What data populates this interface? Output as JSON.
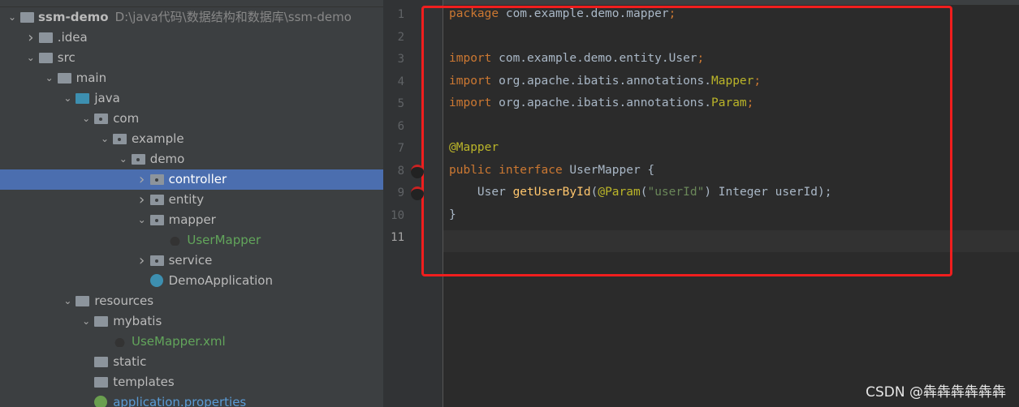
{
  "project": {
    "root": {
      "name": "ssm-demo",
      "path": "D:\\java代码\\数据结构和数据库\\ssm-demo"
    },
    "items": [
      {
        "label": ".idea",
        "level": 1,
        "chevron": "right",
        "icon": "folder"
      },
      {
        "label": "src",
        "level": 1,
        "chevron": "down",
        "icon": "folder"
      },
      {
        "label": "main",
        "level": 2,
        "chevron": "down",
        "icon": "folder"
      },
      {
        "label": "java",
        "level": 3,
        "chevron": "down",
        "icon": "source-folder"
      },
      {
        "label": "com",
        "level": 4,
        "chevron": "down",
        "icon": "package"
      },
      {
        "label": "example",
        "level": 5,
        "chevron": "down",
        "icon": "package"
      },
      {
        "label": "demo",
        "level": 6,
        "chevron": "down",
        "icon": "package"
      },
      {
        "label": "controller",
        "level": 7,
        "chevron": "right",
        "icon": "package",
        "selected": true
      },
      {
        "label": "entity",
        "level": 7,
        "chevron": "right",
        "icon": "package"
      },
      {
        "label": "mapper",
        "level": 7,
        "chevron": "down",
        "icon": "package"
      },
      {
        "label": "UserMapper",
        "level": 8,
        "chevron": "",
        "icon": "mybatis-mapper",
        "color": "green"
      },
      {
        "label": "service",
        "level": 7,
        "chevron": "right",
        "icon": "package"
      },
      {
        "label": "DemoApplication",
        "level": 7,
        "chevron": "",
        "icon": "spring-class"
      },
      {
        "label": "resources",
        "level": 3,
        "chevron": "down",
        "icon": "resources-folder"
      },
      {
        "label": "mybatis",
        "level": 4,
        "chevron": "down",
        "icon": "folder"
      },
      {
        "label": "UseMapper.xml",
        "level": 5,
        "chevron": "",
        "icon": "mybatis-xml",
        "color": "green"
      },
      {
        "label": "static",
        "level": 4,
        "chevron": "",
        "icon": "folder"
      },
      {
        "label": "templates",
        "level": 4,
        "chevron": "",
        "icon": "folder"
      },
      {
        "label": "application.properties",
        "level": 4,
        "chevron": "",
        "icon": "spring-properties",
        "color": "blue"
      }
    ]
  },
  "editor": {
    "current_line": 11,
    "lines": [
      [
        [
          "kw",
          "package"
        ],
        [
          "",
          "com.example.demo.mapper"
        ],
        [
          "kw",
          ";"
        ]
      ],
      [],
      [
        [
          "kw",
          "import"
        ],
        [
          "",
          "com.example.demo.entity.User"
        ],
        [
          "kw",
          ";"
        ]
      ],
      [
        [
          "kw",
          "import"
        ],
        [
          "",
          "org.apache.ibatis.annotations."
        ],
        [
          "ann",
          "Mapper"
        ],
        [
          "kw",
          ";"
        ]
      ],
      [
        [
          "kw",
          "import"
        ],
        [
          "",
          "org.apache.ibatis.annotations."
        ],
        [
          "ann",
          "Param"
        ],
        [
          "kw",
          ";"
        ]
      ],
      [],
      [
        [
          "ann",
          "@Mapper"
        ]
      ],
      [
        [
          "kw",
          "public interface"
        ],
        [
          "",
          "UserMapper {"
        ]
      ],
      [
        [
          "",
          "    User "
        ],
        [
          "fn",
          "getUserById"
        ],
        [
          "",
          "("
        ],
        [
          "ann",
          "@Param"
        ],
        [
          "",
          "("
        ],
        [
          "str",
          "\"userId\""
        ],
        [
          "",
          ") Integer userId);"
        ]
      ],
      [
        [
          "",
          "}"
        ]
      ],
      []
    ],
    "gutter_icons": [
      8,
      9
    ]
  },
  "watermark": "CSDN @犇犇犇犇犇犇",
  "colors": {
    "highlight_box": "#f01e1e",
    "selection": "#4b6eaf"
  }
}
